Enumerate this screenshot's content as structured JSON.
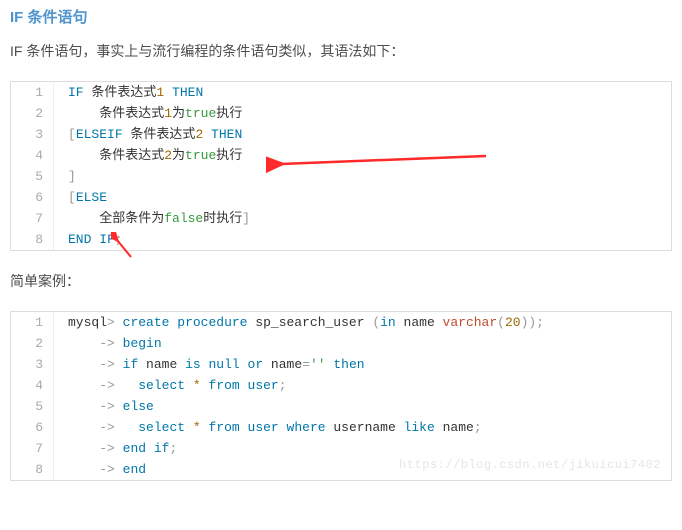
{
  "heading": "IF 条件语句",
  "intro": "IF 条件语句，事实上与流行编程的条件语句类似，其语法如下：",
  "code1": {
    "lines": [
      {
        "n": "1",
        "segs": [
          {
            "t": "IF",
            "c": "kw"
          },
          {
            "t": " 条件表达式",
            "c": ""
          },
          {
            "t": "1",
            "c": "num"
          },
          {
            "t": " THEN",
            "c": "kw"
          }
        ]
      },
      {
        "n": "2",
        "segs": [
          {
            "t": "    条件表达式",
            "c": ""
          },
          {
            "t": "1",
            "c": "num"
          },
          {
            "t": "为",
            "c": ""
          },
          {
            "t": "true",
            "c": "bool"
          },
          {
            "t": "执行",
            "c": ""
          }
        ]
      },
      {
        "n": "3",
        "segs": [
          {
            "t": "[",
            "c": "punc"
          },
          {
            "t": "ELSEIF",
            "c": "kw"
          },
          {
            "t": " 条件表达式",
            "c": ""
          },
          {
            "t": "2",
            "c": "num"
          },
          {
            "t": " THEN",
            "c": "kw"
          }
        ]
      },
      {
        "n": "4",
        "segs": [
          {
            "t": "    条件表达式",
            "c": ""
          },
          {
            "t": "2",
            "c": "num"
          },
          {
            "t": "为",
            "c": ""
          },
          {
            "t": "true",
            "c": "bool"
          },
          {
            "t": "执行",
            "c": ""
          }
        ]
      },
      {
        "n": "5",
        "segs": [
          {
            "t": "]",
            "c": "punc"
          }
        ]
      },
      {
        "n": "6",
        "segs": [
          {
            "t": "[",
            "c": "punc"
          },
          {
            "t": "ELSE",
            "c": "kw"
          }
        ]
      },
      {
        "n": "7",
        "segs": [
          {
            "t": "    全部条件为",
            "c": ""
          },
          {
            "t": "false",
            "c": "bool"
          },
          {
            "t": "时执行",
            "c": ""
          },
          {
            "t": "]",
            "c": "punc"
          }
        ]
      },
      {
        "n": "8",
        "segs": [
          {
            "t": "END IF",
            "c": "kw"
          },
          {
            "t": ";",
            "c": "punc"
          }
        ]
      }
    ]
  },
  "mid": "简单案例：",
  "code2": {
    "lines": [
      {
        "n": "1",
        "segs": [
          {
            "t": "mysql",
            "c": ""
          },
          {
            "t": ">",
            "c": "punc"
          },
          {
            "t": " ",
            "c": ""
          },
          {
            "t": "create",
            "c": "kw"
          },
          {
            "t": " ",
            "c": ""
          },
          {
            "t": "procedure",
            "c": "kw"
          },
          {
            "t": " sp_search_user ",
            "c": ""
          },
          {
            "t": "(",
            "c": "punc"
          },
          {
            "t": "in",
            "c": "kw"
          },
          {
            "t": " name ",
            "c": ""
          },
          {
            "t": "varchar",
            "c": "func"
          },
          {
            "t": "(",
            "c": "punc"
          },
          {
            "t": "20",
            "c": "num"
          },
          {
            "t": ")",
            "c": "punc"
          },
          {
            "t": ")",
            "c": "punc"
          },
          {
            "t": ";",
            "c": "punc"
          }
        ]
      },
      {
        "n": "2",
        "segs": [
          {
            "t": "    ",
            "c": ""
          },
          {
            "t": "->",
            "c": "punc"
          },
          {
            "t": " ",
            "c": ""
          },
          {
            "t": "begin",
            "c": "kw"
          }
        ]
      },
      {
        "n": "3",
        "segs": [
          {
            "t": "    ",
            "c": ""
          },
          {
            "t": "->",
            "c": "punc"
          },
          {
            "t": " ",
            "c": ""
          },
          {
            "t": "if",
            "c": "kw"
          },
          {
            "t": " name ",
            "c": ""
          },
          {
            "t": "is",
            "c": "kw"
          },
          {
            "t": " ",
            "c": ""
          },
          {
            "t": "null",
            "c": "kw"
          },
          {
            "t": " ",
            "c": ""
          },
          {
            "t": "or",
            "c": "kw"
          },
          {
            "t": " name",
            "c": ""
          },
          {
            "t": "=",
            "c": "punc"
          },
          {
            "t": "''",
            "c": "str"
          },
          {
            "t": " ",
            "c": ""
          },
          {
            "t": "then",
            "c": "kw"
          }
        ]
      },
      {
        "n": "4",
        "segs": [
          {
            "t": "    ",
            "c": ""
          },
          {
            "t": "->",
            "c": "punc"
          },
          {
            "t": "   ",
            "c": ""
          },
          {
            "t": "select",
            "c": "kw"
          },
          {
            "t": " ",
            "c": ""
          },
          {
            "t": "*",
            "c": "star"
          },
          {
            "t": " ",
            "c": ""
          },
          {
            "t": "from",
            "c": "kw"
          },
          {
            "t": " ",
            "c": ""
          },
          {
            "t": "user",
            "c": "kw"
          },
          {
            "t": ";",
            "c": "punc"
          }
        ]
      },
      {
        "n": "5",
        "segs": [
          {
            "t": "    ",
            "c": ""
          },
          {
            "t": "->",
            "c": "punc"
          },
          {
            "t": " ",
            "c": ""
          },
          {
            "t": "else",
            "c": "kw"
          }
        ]
      },
      {
        "n": "6",
        "segs": [
          {
            "t": "    ",
            "c": ""
          },
          {
            "t": "->",
            "c": "punc"
          },
          {
            "t": "   ",
            "c": ""
          },
          {
            "t": "select",
            "c": "kw"
          },
          {
            "t": " ",
            "c": ""
          },
          {
            "t": "*",
            "c": "star"
          },
          {
            "t": " ",
            "c": ""
          },
          {
            "t": "from",
            "c": "kw"
          },
          {
            "t": " ",
            "c": ""
          },
          {
            "t": "user",
            "c": "kw"
          },
          {
            "t": " ",
            "c": ""
          },
          {
            "t": "where",
            "c": "kw"
          },
          {
            "t": " username ",
            "c": ""
          },
          {
            "t": "like",
            "c": "kw"
          },
          {
            "t": " name",
            "c": ""
          },
          {
            "t": ";",
            "c": "punc"
          }
        ]
      },
      {
        "n": "7",
        "segs": [
          {
            "t": "    ",
            "c": ""
          },
          {
            "t": "->",
            "c": "punc"
          },
          {
            "t": " ",
            "c": ""
          },
          {
            "t": "end",
            "c": "kw"
          },
          {
            "t": " ",
            "c": ""
          },
          {
            "t": "if",
            "c": "kw"
          },
          {
            "t": ";",
            "c": "punc"
          }
        ]
      },
      {
        "n": "8",
        "segs": [
          {
            "t": "    ",
            "c": ""
          },
          {
            "t": "->",
            "c": "punc"
          },
          {
            "t": " ",
            "c": ""
          },
          {
            "t": "end",
            "c": "kw"
          }
        ]
      }
    ]
  },
  "watermark": "https://blog.csdn.net/jikuicui7402"
}
